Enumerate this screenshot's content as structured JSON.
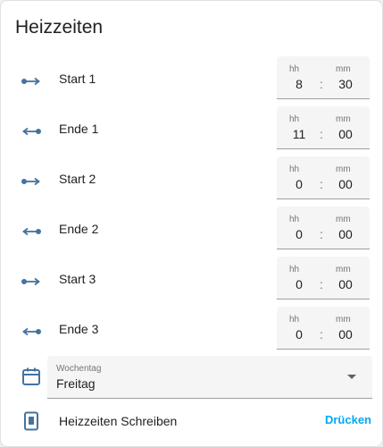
{
  "card": {
    "title": "Heizzeiten"
  },
  "rows": [
    {
      "label": "Start 1",
      "icon": "arrow-right-from-dot-icon",
      "hour_label": "hh",
      "minute_label": "mm",
      "hour": "8",
      "minute": "30",
      "separator": ":"
    },
    {
      "label": "Ende 1",
      "icon": "arrow-left-to-dot-icon",
      "hour_label": "hh",
      "minute_label": "mm",
      "hour": "11",
      "minute": "00",
      "separator": ":"
    },
    {
      "label": "Start 2",
      "icon": "arrow-right-from-dot-icon",
      "hour_label": "hh",
      "minute_label": "mm",
      "hour": "0",
      "minute": "00",
      "separator": ":"
    },
    {
      "label": "Ende 2",
      "icon": "arrow-left-to-dot-icon",
      "hour_label": "hh",
      "minute_label": "mm",
      "hour": "0",
      "minute": "00",
      "separator": ":"
    },
    {
      "label": "Start 3",
      "icon": "arrow-right-from-dot-icon",
      "hour_label": "hh",
      "minute_label": "mm",
      "hour": "0",
      "minute": "00",
      "separator": ":"
    },
    {
      "label": "Ende 3",
      "icon": "arrow-left-to-dot-icon",
      "hour_label": "hh",
      "minute_label": "mm",
      "hour": "0",
      "minute": "00",
      "separator": ":"
    }
  ],
  "weekday_select": {
    "icon": "calendar-icon",
    "label": "Wochentag",
    "value": "Freitag"
  },
  "write_action": {
    "icon": "device-icon",
    "label": "Heizzeiten Schreiben",
    "button_label": "Drücken"
  },
  "colors": {
    "icon": "#44739e",
    "accent": "#03a9f4",
    "text": "#212121",
    "field_bg": "#f5f5f5"
  }
}
